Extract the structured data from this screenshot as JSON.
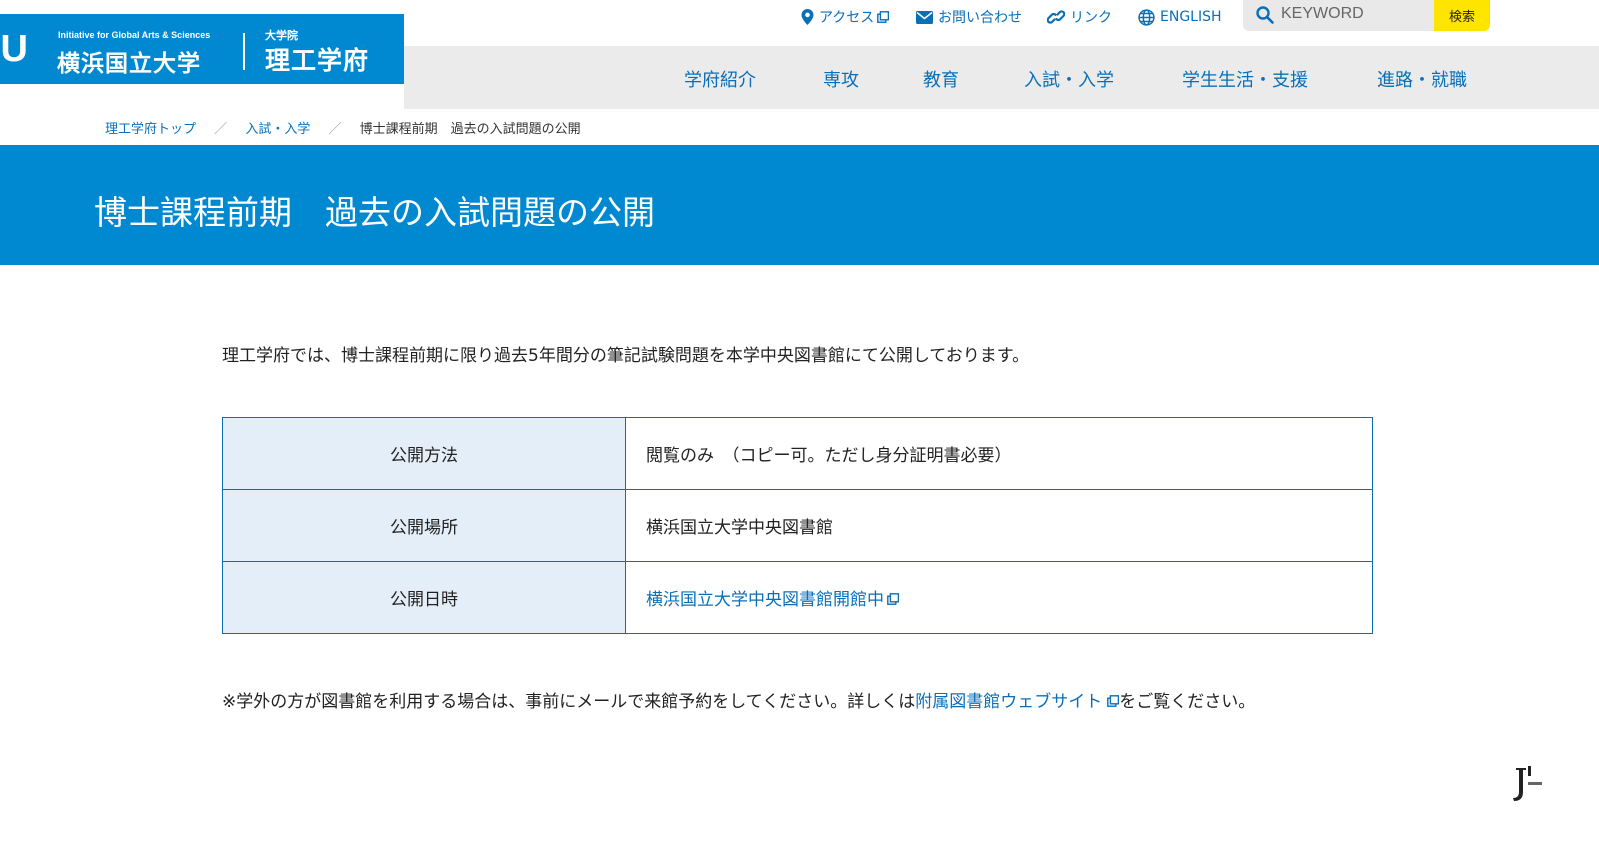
{
  "header": {
    "logo_mark": "IU",
    "logo_english": "Initiative for Global Arts & Sciences",
    "logo_university": "横浜国立大学",
    "logo_graduate": "大学院",
    "logo_school": "理工学府"
  },
  "utility_links": [
    {
      "label": "アクセス",
      "icon": "map-pin-icon"
    },
    {
      "label": "お問い合わせ",
      "icon": "envelope-icon"
    },
    {
      "label": "リンク",
      "icon": "link-icon"
    },
    {
      "label": "ENGLISH",
      "icon": "globe-icon"
    }
  ],
  "search": {
    "placeholder": "KEYWORD",
    "button_label": "検索"
  },
  "nav": [
    "学府紹介",
    "専攻",
    "教育",
    "入試・入学",
    "学生生活・支援",
    "進路・就職"
  ],
  "breadcrumb": {
    "items": [
      "理工学府トップ",
      "入試・入学"
    ],
    "separator": "／",
    "current": "博士課程前期　過去の入試問題の公開"
  },
  "page": {
    "title": "博士課程前期　過去の入試問題の公開",
    "intro": "理工学府では、博士課程前期に限り過去5年間分の筆記試験問題を本学中央図書館にて公開しております。"
  },
  "info_table": [
    {
      "label": "公開方法",
      "value": "閲覧のみ　（コピー可。ただし身分証明書必要）"
    },
    {
      "label": "公開場所",
      "value": "横浜国立大学中央図書館"
    },
    {
      "label": "公開日時",
      "value": "横浜国立大学中央図書館開館中"
    }
  ],
  "note": {
    "before": "※学外の方が図書館を利用する場合は、事前にメールで来館予約をしてください。詳しくは",
    "link": "附属図書館ウェブサイト",
    "after": "をご覧ください。"
  },
  "colors": {
    "brand_blue": "#0088d1",
    "link_blue": "#0a6fb8",
    "search_button": "#ffe400",
    "nav_bg": "#ebebeb",
    "table_header_bg": "#e4eef8"
  }
}
